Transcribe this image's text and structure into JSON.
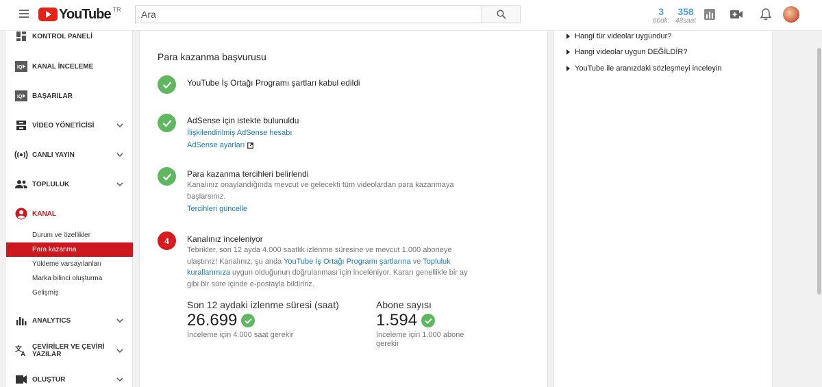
{
  "header": {
    "logo_text": "YouTube",
    "region": "TR",
    "search_placeholder": "Ara",
    "stats": [
      {
        "value": "3",
        "sub": "60dk."
      },
      {
        "value": "358",
        "sub": "48saat"
      }
    ]
  },
  "sidebar": {
    "items": [
      {
        "label": "KONTROL PANELİ",
        "icon": "dashboard-icon"
      },
      {
        "label": "KANAL İNCELEME",
        "icon": "channel-review-icon"
      },
      {
        "label": "BAŞARILAR",
        "icon": "achievements-icon"
      },
      {
        "label": "VİDEO YÖNETİCİSİ",
        "icon": "video-manager-icon"
      },
      {
        "label": "CANLI YAYIN",
        "icon": "live-icon"
      },
      {
        "label": "TOPLULUK",
        "icon": "community-icon"
      },
      {
        "label": "KANAL",
        "icon": "channel-icon"
      },
      {
        "label": "ANALYTICS",
        "icon": "analytics-icon"
      },
      {
        "label": "ÇEVİRİLER VE ÇEVİRİ YAZILAR",
        "icon": "translate-icon"
      },
      {
        "label": "OLUŞTUR",
        "icon": "create-icon"
      }
    ],
    "channel_sub": [
      "Durum ve özellikler",
      "Para kazanma",
      "Yükleme varsayılanları",
      "Marka bilinci oluşturma",
      "Gelişmiş"
    ]
  },
  "main": {
    "title": "Para kazanma başvurusu",
    "step1": {
      "heading": "YouTube İş Ortağı Programı şartları kabul edildi"
    },
    "step2": {
      "heading": "AdSense için istekte bulunuldu",
      "link1": "İlişkilendirilmiş AdSense hesabı",
      "link2": "AdSense ayarları"
    },
    "step3": {
      "heading": "Para kazanma tercihleri belirlendi",
      "desc": "Kanalınız onaylandığında mevcut ve gelecekti tüm videolardan para kazanmaya başlarsınız.",
      "link": "Tercihleri güncelle"
    },
    "step4": {
      "number": "4",
      "heading": "Kanalınız inceleniyor",
      "desc_a": "Tebrikler, son 12 ayda 4.000 saatlik izlenme süresine ve mevcut 1.000 aboneye ulaştınız! Kanalınız, şu anda ",
      "link_a": "YouTube İş Ortağı Programı şartlarına",
      "desc_b": " ve ",
      "link_b": "Topluluk kurallarımıza",
      "desc_c": " uygun olduğunun doğrulanması için inceleniyor. Kararı genellikle bir ay gibi bir süre içinde e-postayla bildiririz."
    },
    "metrics": [
      {
        "label": "Son 12 aydaki izlenme süresi (saat)",
        "value": "26.699",
        "note": "İnceleme için 4.000 saat gerekir"
      },
      {
        "label": "Abone sayısı",
        "value": "1.594",
        "note": "İnceleme için 1.000 abone gerekir"
      }
    ]
  },
  "right": {
    "faq": [
      "Hangi tür videolar uygundur?",
      "Hangi videolar uygun DEĞİLDİR?",
      "YouTube ile aranızdaki sözleşmeyi inceleyin"
    ]
  },
  "colors": {
    "accent": "#cc181e",
    "success": "#5fb760",
    "link": "#167ac6"
  }
}
